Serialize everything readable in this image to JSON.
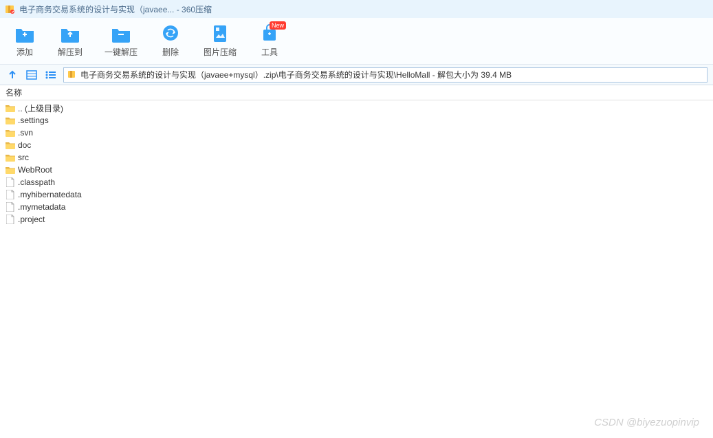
{
  "titlebar": {
    "title": "电子商务交易系统的设计与实现（javaee... - 360压缩"
  },
  "toolbar": {
    "add": "添加",
    "extractTo": "解压到",
    "oneClickExtract": "一键解压",
    "delete": "删除",
    "imageCompress": "图片压缩",
    "tools": "工具",
    "newBadge": "New"
  },
  "navbar": {
    "path": "电子商务交易系统的设计与实现（javaee+mysql）.zip\\电子商务交易系统的设计与实现\\HelloMall - 解包大小为 39.4 MB"
  },
  "columnHeader": {
    "name": "名称"
  },
  "files": [
    {
      "name": ".. (上级目录)",
      "type": "folder"
    },
    {
      "name": ".settings",
      "type": "folder"
    },
    {
      "name": ".svn",
      "type": "folder"
    },
    {
      "name": "doc",
      "type": "folder"
    },
    {
      "name": "src",
      "type": "folder"
    },
    {
      "name": "WebRoot",
      "type": "folder"
    },
    {
      "name": ".classpath",
      "type": "file"
    },
    {
      "name": ".myhibernatedata",
      "type": "file"
    },
    {
      "name": ".mymetadata",
      "type": "file"
    },
    {
      "name": ".project",
      "type": "file"
    }
  ],
  "watermark": "CSDN @biyezuopinvip"
}
